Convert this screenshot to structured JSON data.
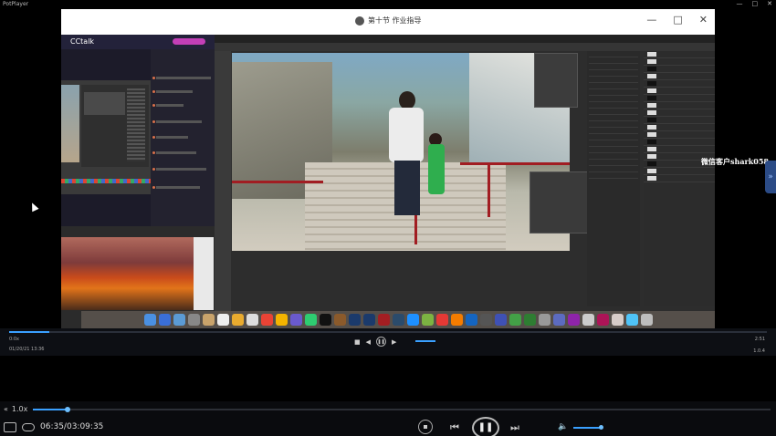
{
  "app": {
    "title": "PotPlayer"
  },
  "lecture": {
    "window_title": "第十节 作业指导",
    "cctalk_brand": "CCtalk"
  },
  "overlay": {
    "watermark": "微信客户shark058"
  },
  "inner_player": {
    "time_left": "0:0x",
    "time_right": "2:51",
    "date": "01/20/21 13:36",
    "version": "1.0.4"
  },
  "player": {
    "speed_label": "1.0x",
    "current_time": "06:35",
    "total_time": "03:09:35",
    "timecode": "06:35/03:09:35",
    "progress": 0.047,
    "volume": 0.85,
    "accent_color": "#3aa0ff"
  },
  "icons": {
    "speed_toggle": "chevrons-left-icon",
    "folder": "folder-icon",
    "loop": "loop-icon",
    "stop": "stop-icon",
    "prev": "skip-back-icon",
    "pause": "pause-icon",
    "next": "skip-forward-icon",
    "volume": "volume-icon",
    "side_panel": "chevron-right-icon"
  }
}
